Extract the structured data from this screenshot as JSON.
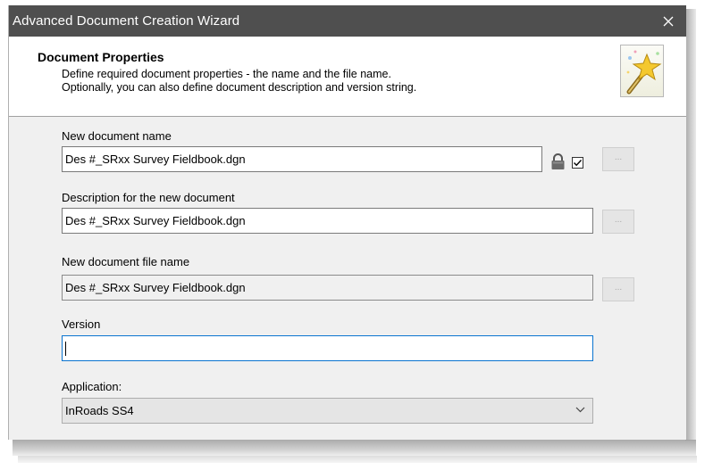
{
  "window": {
    "title": "Advanced Document Creation Wizard",
    "close_label": "✕"
  },
  "header": {
    "title": "Document Properties",
    "description_line1": "Define required document properties - the name and the file name.",
    "description_line2": "Optionally, you can also define document description and version string.",
    "icon": "wizard-wand-icon"
  },
  "fields": {
    "doc_name": {
      "label": "New document name",
      "value": "Des #_SRxx Survey Fieldbook.dgn",
      "locked": true,
      "checked": true,
      "browse_label": "..."
    },
    "description": {
      "label": "Description for the new document",
      "value": "Des #_SRxx Survey Fieldbook.dgn",
      "browse_label": "..."
    },
    "file_name": {
      "label": "New document file name",
      "value": "Des #_SRxx Survey Fieldbook.dgn",
      "browse_label": "..."
    },
    "version": {
      "label": "Version",
      "value": ""
    },
    "application": {
      "label": "Application:",
      "selected": "InRoads SS4"
    }
  },
  "colors": {
    "titlebar": "#4f4f4f",
    "focus_border": "#0a74d0"
  }
}
